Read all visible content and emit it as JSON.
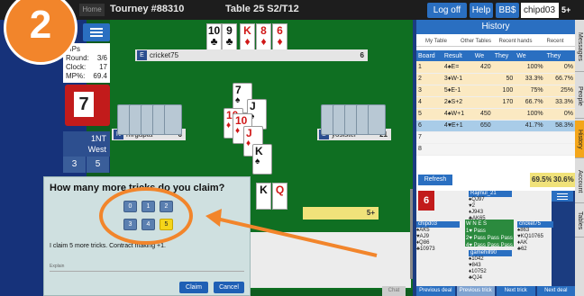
{
  "header": {
    "home": "Home",
    "tourney": "Tourney #88310",
    "table": "Table 25 S2/T12",
    "logoff": "Log off",
    "help": "Help",
    "bbs": "BB$",
    "username": "chipd03",
    "score": "5+"
  },
  "step_number": "2",
  "sidebar": {
    "info": {
      "mps": "MPs",
      "round_label": "Round:",
      "round_value": "3/6",
      "clock_label": "Clock:",
      "clock_value": "17",
      "mp_label": "MP%:",
      "mp_value": "69.4"
    },
    "tricks": "7",
    "contract": "1NT",
    "declarer": "West",
    "tally_ns": "3",
    "tally_ew": "5"
  },
  "table": {
    "north": {
      "dir": "E",
      "name": "cricket75",
      "num": "6"
    },
    "west": {
      "dir": "N",
      "name": "mrgupta",
      "num": "6"
    },
    "east": {
      "dir": "S",
      "name": "yosister",
      "num": "21"
    },
    "score_strip": "5+",
    "north_hand": [
      {
        "rank": "10",
        "suit": "♣",
        "color": "blk"
      },
      {
        "rank": "9",
        "suit": "♣",
        "color": "blk"
      },
      {
        "rank": "K",
        "suit": "♦",
        "color": "red"
      },
      {
        "rank": "8",
        "suit": "♦",
        "color": "red"
      },
      {
        "rank": "6",
        "suit": "♦",
        "color": "red"
      }
    ],
    "trick_cards": [
      {
        "rank": "7",
        "suit": "♠",
        "color": "blk"
      },
      {
        "rank": "10",
        "suit": "♦",
        "color": "red"
      },
      {
        "rank": "J",
        "suit": "♠",
        "color": "blk"
      },
      {
        "rank": "10",
        "suit": "♦",
        "color": "red"
      },
      {
        "rank": "J",
        "suit": "♦",
        "color": "red"
      },
      {
        "rank": "K",
        "suit": "♠",
        "color": "blk"
      }
    ],
    "south_hand": [
      {
        "rank": "K",
        "color": "blk"
      },
      {
        "rank": "Q",
        "color": "red"
      }
    ]
  },
  "history": {
    "title": "History",
    "tabs": [
      "My Table",
      "Other Tables",
      "Recent hands",
      "Recent"
    ],
    "columns": [
      "Board",
      "Result",
      "We",
      "They",
      "We",
      "They"
    ],
    "rows": [
      {
        "board": "1",
        "result": "4♠E=",
        "we": "420",
        "they": "",
        "we2": "100%",
        "they2": "0%"
      },
      {
        "board": "2",
        "result": "3♦W-1",
        "we": "",
        "they": "50",
        "we2": "33.3%",
        "they2": "66.7%"
      },
      {
        "board": "3",
        "result": "5♦E-1",
        "we": "",
        "they": "100",
        "we2": "75%",
        "they2": "25%"
      },
      {
        "board": "4",
        "result": "2♠S+2",
        "we": "",
        "they": "170",
        "we2": "66.7%",
        "they2": "33.3%"
      },
      {
        "board": "5",
        "result": "4♠W+1",
        "we": "450",
        "they": "",
        "we2": "100%",
        "they2": "0%"
      },
      {
        "board": "6",
        "result": "4♥E+1",
        "we": "650",
        "they": "",
        "we2": "41.7%",
        "they2": "58.3%"
      },
      {
        "board": "7",
        "result": "",
        "we": "",
        "they": "",
        "we2": "",
        "they2": ""
      },
      {
        "board": "8",
        "result": "",
        "we": "",
        "they": "",
        "we2": "",
        "they2": ""
      }
    ],
    "refresh": "Refresh",
    "total_we": "69.5%",
    "total_they": "30.6%"
  },
  "side_tabs": [
    "Messages",
    "People",
    "History",
    "Account",
    "Tables"
  ],
  "diagram": {
    "board": "6",
    "north_name": "Rajmul_21",
    "north_cards": [
      "♠QJ97",
      "♥2",
      "♦J943",
      "♣AK65"
    ],
    "west_name": "chipd03",
    "west_cards": [
      "♠AK5",
      "♥AJ9",
      "♦Q86",
      "♣10973"
    ],
    "east_name": "cricket75",
    "east_cards": [
      "♠863",
      "♥KQ10765",
      "♦AK",
      "♣62"
    ],
    "south_name": "gamehill90",
    "south_cards": [
      "♠1042",
      "♥843",
      "♦10752",
      "♣QJ4"
    ],
    "bidding_header": "W  N  E  S",
    "bidding_rows": [
      "1♥ Pass",
      "2♥ Pass Pass Pass",
      "4♥ Pass Pass Pass"
    ]
  },
  "bottom_buttons": [
    "Previous deal",
    "Previous trick",
    "Next trick",
    "Next deal"
  ],
  "faint_button": "Chat",
  "claim": {
    "title": "How many more tricks do you claim?",
    "options": [
      "0",
      "1",
      "2",
      "3",
      "4",
      "5"
    ],
    "selected": "5",
    "description": "I claim 5 more tricks. Contract making +1.",
    "explain_label": "Explain",
    "claim_button": "Claim",
    "cancel_button": "Cancel"
  },
  "colors": {
    "felt": "#0f6f22",
    "brand_blue": "#2a6fc1",
    "highlight_orange": "#f2852b",
    "selected_yellow": "#f5d51a"
  }
}
